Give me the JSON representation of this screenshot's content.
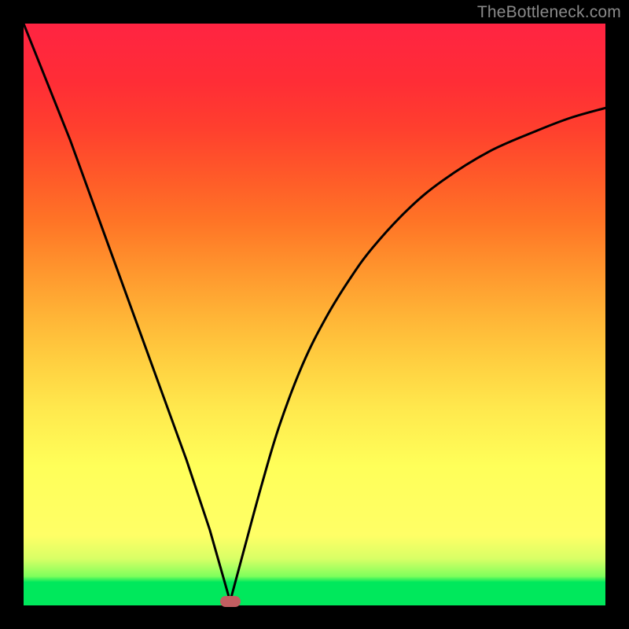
{
  "watermark": "TheBottleneck.com",
  "marker": {
    "x": 0.355,
    "ybar": 0.007
  },
  "curve_left": {
    "x": [
      0.0,
      0.04,
      0.08,
      0.12,
      0.16,
      0.2,
      0.24,
      0.28,
      0.32,
      0.355
    ],
    "ybar": [
      1.0,
      0.9,
      0.8,
      0.69,
      0.58,
      0.47,
      0.36,
      0.25,
      0.13,
      0.007
    ]
  },
  "curve_right": {
    "x": [
      0.355,
      0.38,
      0.41,
      0.44,
      0.48,
      0.52,
      0.56,
      0.6,
      0.66,
      0.72,
      0.8,
      0.88,
      0.94,
      1.0
    ],
    "ybar": [
      0.007,
      0.1,
      0.21,
      0.31,
      0.415,
      0.495,
      0.56,
      0.615,
      0.68,
      0.73,
      0.78,
      0.815,
      0.838,
      0.855
    ]
  },
  "chart_data": {
    "type": "line",
    "title": "",
    "xlabel": "",
    "ylabel": "",
    "xlim": [
      0,
      1
    ],
    "ylim": [
      0,
      1
    ],
    "series": [
      {
        "name": "bottleneck-curve",
        "x": [
          0.0,
          0.04,
          0.08,
          0.12,
          0.16,
          0.2,
          0.24,
          0.28,
          0.32,
          0.355,
          0.38,
          0.41,
          0.44,
          0.48,
          0.52,
          0.56,
          0.6,
          0.66,
          0.72,
          0.8,
          0.88,
          0.94,
          1.0
        ],
        "values": [
          1.0,
          0.9,
          0.8,
          0.69,
          0.58,
          0.47,
          0.36,
          0.25,
          0.13,
          0.007,
          0.1,
          0.21,
          0.31,
          0.415,
          0.495,
          0.56,
          0.615,
          0.68,
          0.73,
          0.78,
          0.815,
          0.838,
          0.855
        ]
      }
    ],
    "annotations": [
      {
        "name": "optimal-marker",
        "x": 0.355,
        "y": 0.007
      }
    ],
    "background": "red-yellow-green vertical gradient (green at bottom = good)"
  }
}
